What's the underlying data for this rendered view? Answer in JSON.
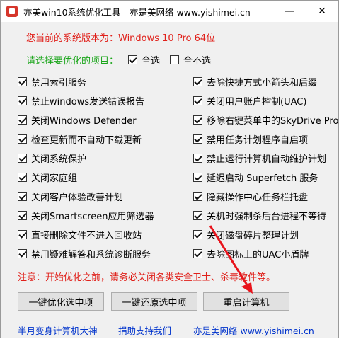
{
  "window": {
    "title": "亦美win10系统优化工具 - 亦是美网络 www.yishimei.cn",
    "minimize": "—",
    "close": "✕"
  },
  "version_text": "您当前的系统版本为：Windows 10 Pro  64位",
  "select_prompt": "请选择要优化的项目：",
  "select_all": {
    "label": "全选",
    "checked": true
  },
  "select_none": {
    "label": "全不选",
    "checked": false
  },
  "options_left": [
    {
      "label": "禁用索引服务",
      "checked": true
    },
    {
      "label": "禁止windows发送错误报告",
      "checked": true
    },
    {
      "label": "关闭Windows Defender",
      "checked": true
    },
    {
      "label": "检查更新而不自动下载更新",
      "checked": true
    },
    {
      "label": "关闭系统保护",
      "checked": true
    },
    {
      "label": "关闭家庭组",
      "checked": true
    },
    {
      "label": "关闭客户体验改善计划",
      "checked": true
    },
    {
      "label": "关闭Smartscreen应用筛选器",
      "checked": true
    },
    {
      "label": "直接删除文件不进入回收站",
      "checked": true
    },
    {
      "label": "禁用疑难解答和系统诊断服务",
      "checked": true
    }
  ],
  "options_right": [
    {
      "label": "去除快捷方式小箭头和后缀",
      "checked": true
    },
    {
      "label": "关闭用户账户控制(UAC)",
      "checked": true
    },
    {
      "label": "移除右键菜单中的SkyDrive Pro",
      "checked": true
    },
    {
      "label": "禁用任务计划程序自启项",
      "checked": true
    },
    {
      "label": "禁止运行计算机自动维护计划",
      "checked": true
    },
    {
      "label": "延迟启动 Superfetch 服务",
      "checked": true
    },
    {
      "label": "隐藏操作中心任务栏托盘",
      "checked": true
    },
    {
      "label": "关机时强制杀后台进程不等待",
      "checked": true
    },
    {
      "label": "关闭磁盘碎片整理计划",
      "checked": true
    },
    {
      "label": "去除图标上的UAC小盾牌",
      "checked": true
    }
  ],
  "notice": "注意：开始优化之前，请务必关闭各类安全卫士、杀毒软件等。",
  "buttons": {
    "optimize": "一键优化选中项",
    "restore": "一键还原选中项",
    "restart": "重启计算机"
  },
  "links": {
    "left": "半月变身计算机大神",
    "middle": "捐助支持我们",
    "right": "亦是美网络 www.yishimei.cn"
  },
  "colors": {
    "accent_red": "#e0201a",
    "green": "#1aa51a",
    "link_blue": "#0033cc",
    "arrow_red": "#e8141c"
  }
}
